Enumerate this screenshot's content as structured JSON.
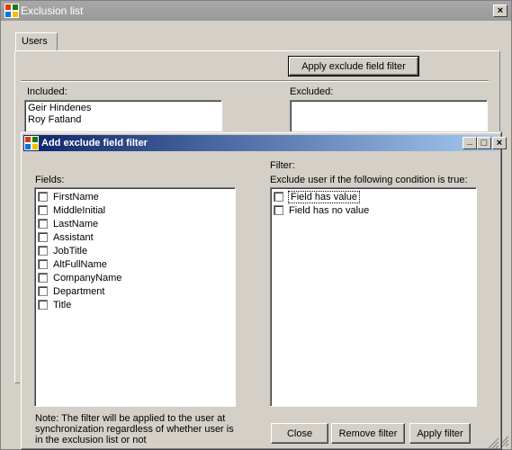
{
  "outer_window": {
    "title": "Exclusion list",
    "close_glyph": "×"
  },
  "users_tab": {
    "label": "Users",
    "apply_filter_button": "Apply exclude field filter",
    "included_label": "Included:",
    "excluded_label": "Excluded:",
    "included_items": [
      "Geir Hindenes",
      "Roy Fatland"
    ]
  },
  "dialog": {
    "title": "Add exclude field filter",
    "fields_label": "Fields:",
    "fields": [
      "FirstName",
      "MiddleInitial",
      "LastName",
      "Assistant",
      "JobTitle",
      "AltFullName",
      "CompanyName",
      "Department",
      "Title"
    ],
    "filter_label": "Filter:",
    "condition_label": "Exclude user if the following condition is true:",
    "conditions": [
      "Field has value",
      "Field has no value"
    ],
    "note": "Note: The filter will be applied to the user at synchronization regardless of whether user is in the exclusion list or not",
    "close_button": "Close",
    "remove_button": "Remove filter",
    "apply_button": "Apply filter",
    "minimize_glyph": "_",
    "maximize_glyph": "□",
    "close_glyph": "×"
  }
}
